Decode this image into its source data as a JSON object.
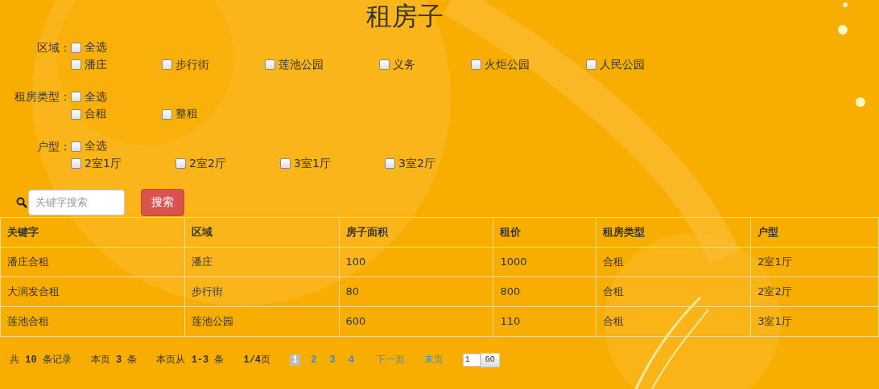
{
  "title": "租房子",
  "filters": [
    {
      "label": "区域：",
      "select_all": {
        "label": "全选",
        "checked": false
      },
      "options": [
        {
          "label": "潘庄",
          "checked": false
        },
        {
          "label": "步行街",
          "checked": false
        },
        {
          "label": "莲池公园",
          "checked": false
        },
        {
          "label": "义务",
          "checked": false
        },
        {
          "label": "火炬公园",
          "checked": false
        },
        {
          "label": "人民公园",
          "checked": false
        }
      ]
    },
    {
      "label": "租房类型：",
      "select_all": {
        "label": "全选",
        "checked": false
      },
      "options": [
        {
          "label": "合租",
          "checked": false
        },
        {
          "label": "整租",
          "checked": false
        }
      ]
    },
    {
      "label": "户型：",
      "select_all": {
        "label": "全选",
        "checked": false
      },
      "options": [
        {
          "label": "2室1厅",
          "checked": false
        },
        {
          "label": "2室2厅",
          "checked": false
        },
        {
          "label": "3室1厅",
          "checked": false
        },
        {
          "label": "3室2厅",
          "checked": false
        }
      ]
    }
  ],
  "search": {
    "placeholder": "关键字搜索",
    "button": "搜索"
  },
  "table": {
    "columns": [
      "关键字",
      "区域",
      "房子面积",
      "租价",
      "租房类型",
      "户型"
    ],
    "rows": [
      [
        "潘庄合租",
        "潘庄",
        "100",
        "1000",
        "合租",
        "2室1厅"
      ],
      [
        "大润发合租",
        "步行街",
        "80",
        "800",
        "合租",
        "2室2厅"
      ],
      [
        "莲池合租",
        "莲池公园",
        "600",
        "110",
        "合租",
        "3室1厅"
      ]
    ]
  },
  "pagination": {
    "summary": [
      "共 **10** 条记录",
      "本页 **3** 条",
      "本页从 **1-3** 条",
      "**1/4**页"
    ],
    "pages": [
      {
        "label": "1",
        "selected": true
      },
      {
        "label": "2",
        "selected": false
      },
      {
        "label": "3",
        "selected": false
      },
      {
        "label": "4",
        "selected": false
      }
    ],
    "next": "下一页",
    "last": "末页",
    "page_input": "1",
    "go": "GO"
  }
}
